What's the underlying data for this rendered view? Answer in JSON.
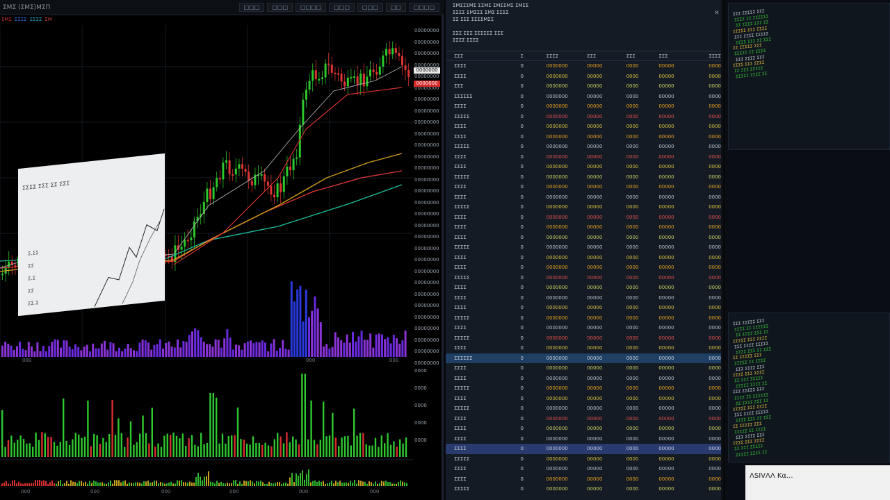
{
  "chart": {
    "title": "ΣΜΣ (ΣΜΣ)ΜΣΠ",
    "toolbar": [
      "□□□",
      "□□□",
      "□□□□",
      "□□□",
      "□□□",
      "□□",
      "□□□□"
    ],
    "legend": [
      {
        "text": "ΣΜΣ",
        "color": "#d03030"
      },
      {
        "text": "ΣΣΣΣ",
        "color": "#3070e0"
      },
      {
        "text": "ΣΣΣΣ",
        "color": "#2aa8c0"
      },
      {
        "text": "ΣΜ",
        "color": "#c84040"
      }
    ],
    "price_ticks": [
      "00000000",
      "00000000",
      "00000000",
      "00000000",
      "00000000",
      "00000000",
      "00000000",
      "00000000",
      "00000000",
      "00000000",
      "00000000",
      "00000000",
      "00000000",
      "00000000",
      "00000000",
      "00000000",
      "00000000",
      "00000000",
      "00000000",
      "00000000",
      "00000000",
      "00000000",
      "00000000",
      "00000000",
      "00000000",
      "00000000",
      "00000000",
      "00000000",
      "00000000",
      "00000000"
    ],
    "price_tags": [
      {
        "text": "0000000",
        "bg": "#e8e8e8",
        "fg": "#111"
      },
      {
        "text": "0000000",
        "bg": "#d42a2a",
        "fg": "#fff"
      }
    ],
    "x_ticks": [
      "000",
      "000",
      "000"
    ],
    "ind_ticks": [
      "0000",
      "0000",
      "0000",
      "0000",
      "0000"
    ],
    "x_ticks_2": [
      "000",
      "000",
      "000",
      "000",
      "000",
      "000"
    ],
    "colors": {
      "up": "#2bc92b",
      "down": "#e03434",
      "ma1": "#1fbfa0",
      "ma2": "#e03a3a",
      "ma3": "#d4a020",
      "ma4": "#b0b0b0"
    }
  },
  "watchlist": {
    "header_lines": [
      "ΣΜΣΣΣΜΣ ΣΣΜΣ   ΣΜΣΣΜΣ ΣΜΣΣ",
      "ΣΣΣΣ ΣΜΣΣΣ   ΣΜΣ ΣΣΣΣ",
      "ΣΣ ΣΣΣ   ΣΣΣΣΜΣΣ",
      "",
      "ΣΣΣ ΣΣΣ ΣΣΣΣΣΣ ΣΣΣ",
      "ΣΣΣΣ ΣΣΣΣ"
    ],
    "columns": [
      "ΣΣΣ",
      "Σ",
      "ΣΣΣΣ",
      "ΣΣΣ",
      "ΣΣΣ",
      "ΣΣΣ",
      "ΣΣΣΣ"
    ],
    "rows": [
      {
        "sym": "ΣΣΣΣ",
        "flag": "0",
        "last": "0000000",
        "chg": "00000",
        "vol": "0000",
        "hi": "00000",
        "pct": "0000",
        "color": "#e8a020"
      },
      {
        "sym": "ΣΣΣΣ",
        "flag": "0",
        "last": "0000000",
        "chg": "00000",
        "vol": "0000",
        "hi": "00000",
        "pct": "0000",
        "color": "#d8c040"
      },
      {
        "sym": "ΣΣΣ",
        "flag": "0",
        "last": "0000000",
        "chg": "00000",
        "vol": "0000",
        "hi": "00000",
        "pct": "0000",
        "color": "#c8d060"
      },
      {
        "sym": "ΣΣΣΣΣΣ",
        "flag": "0",
        "last": "0000000",
        "chg": "00000",
        "vol": "0000",
        "hi": "00000",
        "pct": "0000",
        "color": "#b8c0c8"
      },
      {
        "sym": "ΣΣΣΣ",
        "flag": "0",
        "last": "0000000",
        "chg": "00000",
        "vol": "0000",
        "hi": "00000",
        "pct": "0000",
        "color": "#e8a020"
      },
      {
        "sym": "ΣΣΣΣΣ",
        "flag": "0",
        "last": "0000000",
        "chg": "00000",
        "vol": "0000",
        "hi": "00000",
        "pct": "0000",
        "color": "#e05050"
      },
      {
        "sym": "ΣΣΣΣ",
        "flag": "0",
        "last": "0000000",
        "chg": "00000",
        "vol": "0000",
        "hi": "00000",
        "pct": "0000",
        "color": "#d8c040"
      },
      {
        "sym": "ΣΣΣΣ",
        "flag": "0",
        "last": "0000000",
        "chg": "00000",
        "vol": "0000",
        "hi": "00000",
        "pct": "0000",
        "color": "#e8a020"
      },
      {
        "sym": "ΣΣΣΣΣ",
        "flag": "0",
        "last": "0000000",
        "chg": "00000",
        "vol": "0000",
        "hi": "00000",
        "pct": "0000",
        "color": "#b8c0c8"
      },
      {
        "sym": "ΣΣΣΣ",
        "flag": "0",
        "last": "0000000",
        "chg": "00000",
        "vol": "0000",
        "hi": "00000",
        "pct": "0000",
        "color": "#e05050"
      },
      {
        "sym": "ΣΣΣΣ",
        "flag": "0",
        "last": "0000000",
        "chg": "00000",
        "vol": "0000",
        "hi": "00000",
        "pct": "0000",
        "color": "#d8c040"
      },
      {
        "sym": "ΣΣΣΣΣ",
        "flag": "0",
        "last": "0000000",
        "chg": "00000",
        "vol": "0000",
        "hi": "00000",
        "pct": "0000",
        "color": "#c8d060"
      },
      {
        "sym": "ΣΣΣΣ",
        "flag": "0",
        "last": "0000000",
        "chg": "00000",
        "vol": "0000",
        "hi": "00000",
        "pct": "0000",
        "color": "#e8a020"
      },
      {
        "sym": "ΣΣΣΣ",
        "flag": "0",
        "last": "0000000",
        "chg": "00000",
        "vol": "0000",
        "hi": "00000",
        "pct": "0000",
        "color": "#b8c0c8"
      },
      {
        "sym": "ΣΣΣΣΣ",
        "flag": "0",
        "last": "0000000",
        "chg": "00000",
        "vol": "0000",
        "hi": "00000",
        "pct": "0000",
        "color": "#d8c040"
      },
      {
        "sym": "ΣΣΣΣ",
        "flag": "0",
        "last": "0000000",
        "chg": "00000",
        "vol": "0000",
        "hi": "00000",
        "pct": "0000",
        "color": "#e05050"
      },
      {
        "sym": "ΣΣΣΣ",
        "flag": "0",
        "last": "0000000",
        "chg": "00000",
        "vol": "0000",
        "hi": "00000",
        "pct": "0000",
        "color": "#e8a020"
      },
      {
        "sym": "ΣΣΣΣ",
        "flag": "0",
        "last": "0000000",
        "chg": "00000",
        "vol": "0000",
        "hi": "00000",
        "pct": "0000",
        "color": "#c8d060"
      },
      {
        "sym": "ΣΣΣΣΣ",
        "flag": "0",
        "last": "0000000",
        "chg": "00000",
        "vol": "0000",
        "hi": "00000",
        "pct": "0000",
        "color": "#b8c0c8"
      },
      {
        "sym": "ΣΣΣΣ",
        "flag": "0",
        "last": "0000000",
        "chg": "00000",
        "vol": "0000",
        "hi": "00000",
        "pct": "0000",
        "color": "#d8c040"
      },
      {
        "sym": "ΣΣΣΣ",
        "flag": "0",
        "last": "0000000",
        "chg": "00000",
        "vol": "0000",
        "hi": "00000",
        "pct": "0000",
        "color": "#e8a020"
      },
      {
        "sym": "ΣΣΣΣΣ",
        "flag": "0",
        "last": "0000000",
        "chg": "00000",
        "vol": "0000",
        "hi": "00000",
        "pct": "0000",
        "color": "#e05050"
      },
      {
        "sym": "ΣΣΣΣ",
        "flag": "0",
        "last": "0000000",
        "chg": "00000",
        "vol": "0000",
        "hi": "00000",
        "pct": "0000",
        "color": "#c8d060"
      },
      {
        "sym": "ΣΣΣΣ",
        "flag": "0",
        "last": "0000000",
        "chg": "00000",
        "vol": "0000",
        "hi": "00000",
        "pct": "0000",
        "color": "#b8c0c8"
      },
      {
        "sym": "ΣΣΣΣ",
        "flag": "0",
        "last": "0000000",
        "chg": "00000",
        "vol": "0000",
        "hi": "00000",
        "pct": "0000",
        "color": "#d8c040"
      },
      {
        "sym": "ΣΣΣΣΣ",
        "flag": "0",
        "last": "0000000",
        "chg": "00000",
        "vol": "0000",
        "hi": "00000",
        "pct": "0000",
        "color": "#e8a020"
      },
      {
        "sym": "ΣΣΣΣ",
        "flag": "0",
        "last": "0000000",
        "chg": "00000",
        "vol": "0000",
        "hi": "00000",
        "pct": "0000",
        "color": "#b8c0c8"
      },
      {
        "sym": "ΣΣΣΣΣ",
        "flag": "0",
        "last": "0000000",
        "chg": "00000",
        "vol": "0000",
        "hi": "00000",
        "pct": "0000",
        "color": "#e05050"
      },
      {
        "sym": "ΣΣΣΣ",
        "flag": "0",
        "last": "0000000",
        "chg": "00000",
        "vol": "0000",
        "hi": "00000",
        "pct": "0000",
        "color": "#d8c040"
      },
      {
        "sym": "ΣΣΣΣΣΣ",
        "flag": "0",
        "last": "0000000",
        "chg": "00000",
        "vol": "0000",
        "hi": "00000",
        "pct": "0000",
        "color": "#c8d4e0",
        "selected": "sel"
      },
      {
        "sym": "ΣΣΣΣ",
        "flag": "0",
        "last": "0000000",
        "chg": "00000",
        "vol": "0000",
        "hi": "00000",
        "pct": "0000",
        "color": "#c8d060"
      },
      {
        "sym": "ΣΣΣΣ",
        "flag": "0",
        "last": "0000000",
        "chg": "00000",
        "vol": "0000",
        "hi": "00000",
        "pct": "0000",
        "color": "#b8c0c8"
      },
      {
        "sym": "ΣΣΣΣΣ",
        "flag": "0",
        "last": "0000000",
        "chg": "00000",
        "vol": "0000",
        "hi": "00000",
        "pct": "0000",
        "color": "#e8a020"
      },
      {
        "sym": "ΣΣΣΣ",
        "flag": "0",
        "last": "0000000",
        "chg": "00000",
        "vol": "0000",
        "hi": "00000",
        "pct": "0000",
        "color": "#d8c040"
      },
      {
        "sym": "ΣΣΣΣΣ",
        "flag": "0",
        "last": "0000000",
        "chg": "00000",
        "vol": "0000",
        "hi": "00000",
        "pct": "0000",
        "color": "#b8c0c8"
      },
      {
        "sym": "ΣΣΣΣ",
        "flag": "0",
        "last": "0000000",
        "chg": "00000",
        "vol": "0000",
        "hi": "00000",
        "pct": "0000",
        "color": "#e05050"
      },
      {
        "sym": "ΣΣΣΣ",
        "flag": "0",
        "last": "0000000",
        "chg": "00000",
        "vol": "0000",
        "hi": "00000",
        "pct": "0000",
        "color": "#c8d060"
      },
      {
        "sym": "ΣΣΣΣ",
        "flag": "0",
        "last": "0000000",
        "chg": "00000",
        "vol": "0000",
        "hi": "00000",
        "pct": "0000",
        "color": "#b8c0c8"
      },
      {
        "sym": "ΣΣΣΣ",
        "flag": "0",
        "last": "0000000",
        "chg": "00000",
        "vol": "0000",
        "hi": "00000",
        "pct": "0000",
        "color": "#c8d4e0",
        "selected": "sel2"
      },
      {
        "sym": "ΣΣΣΣΣ",
        "flag": "0",
        "last": "0000000",
        "chg": "00000",
        "vol": "0000",
        "hi": "00000",
        "pct": "0000",
        "color": "#d8c040"
      },
      {
        "sym": "ΣΣΣΣ",
        "flag": "0",
        "last": "0000000",
        "chg": "00000",
        "vol": "0000",
        "hi": "00000",
        "pct": "0000",
        "color": "#b8c0c8"
      },
      {
        "sym": "ΣΣΣΣ",
        "flag": "0",
        "last": "0000000",
        "chg": "00000",
        "vol": "0000",
        "hi": "00000",
        "pct": "0000",
        "color": "#e8a020"
      },
      {
        "sym": "ΣΣΣΣΣ",
        "flag": "0",
        "last": "0000000",
        "chg": "00000",
        "vol": "0000",
        "hi": "00000",
        "pct": "0000",
        "color": "#c8d060"
      }
    ]
  },
  "monitors": {
    "top_lines": [
      "ΣΣΣ ΣΣΣΣΣ ΣΣΣ",
      "ΣΣΣΣ ΣΣ ΣΣΣΣΣΣ",
      "ΣΣ ΣΣΣΣ ΣΣΣ ΣΣ",
      "ΣΣΣΣΣ ΣΣΣ ΣΣΣΣ",
      "ΣΣΣ ΣΣΣΣ ΣΣΣΣΣ",
      "ΣΣΣΣ ΣΣΣ ΣΣ ΣΣΣ",
      "ΣΣ ΣΣΣΣΣ ΣΣΣ",
      "ΣΣΣΣΣ ΣΣ ΣΣΣΣ",
      "ΣΣΣ ΣΣΣΣ ΣΣΣ",
      "ΣΣΣΣ ΣΣΣ ΣΣΣΣ",
      "ΣΣ ΣΣΣ ΣΣΣΣΣ",
      "ΣΣΣΣΣ ΣΣΣΣ ΣΣ"
    ],
    "paper_title": "ΣΣΣΣ ΣΣΣ ΣΣ ΣΣΣ",
    "paper_rows": [
      "Σ.ΣΣ",
      "ΣΣ",
      "Σ.Σ",
      "ΣΣ",
      "ΣΣ.Σ"
    ],
    "bottom_lines": [
      "ΣΣΣ ΣΣΣΣΣ ΣΣΣ",
      "ΣΣΣΣ ΣΣ ΣΣΣΣΣΣ",
      "ΣΣ ΣΣΣΣ ΣΣΣ ΣΣ",
      "ΣΣΣΣΣ ΣΣΣ ΣΣΣΣ",
      "ΣΣΣ ΣΣΣΣ ΣΣΣΣΣ",
      "ΣΣΣΣ ΣΣΣ ΣΣ ΣΣΣ",
      "ΣΣ ΣΣΣΣΣ ΣΣΣ",
      "ΣΣΣΣΣ ΣΣ ΣΣΣΣ",
      "ΣΣΣ ΣΣΣΣ ΣΣΣ",
      "ΣΣΣΣ ΣΣΣ ΣΣΣΣ",
      "ΣΣ ΣΣΣ ΣΣΣΣΣ",
      "ΣΣΣΣΣ ΣΣΣΣ ΣΣ",
      "ΣΣΣ ΣΣΣΣΣ ΣΣΣ",
      "ΣΣΣΣ ΣΣ ΣΣΣΣΣΣ",
      "ΣΣ ΣΣΣΣ ΣΣΣ ΣΣ",
      "ΣΣΣΣΣ ΣΣΣ ΣΣΣΣ",
      "ΣΣΣ ΣΣΣΣ ΣΣΣΣΣ",
      "ΣΣΣΣ ΣΣΣ ΣΣ ΣΣΣ",
      "ΣΣ ΣΣΣΣΣ ΣΣΣ",
      "ΣΣΣΣΣ ΣΣ ΣΣΣΣ",
      "ΣΣΣ ΣΣΣΣ ΣΣΣ",
      "ΣΣΣΣ ΣΣΣ ΣΣΣΣ",
      "ΣΣ ΣΣΣ ΣΣΣΣΣ",
      "ΣΣΣΣΣ ΣΣΣΣ ΣΣ"
    ],
    "badge_text": "ΛSIVΛΛ Kα..."
  }
}
